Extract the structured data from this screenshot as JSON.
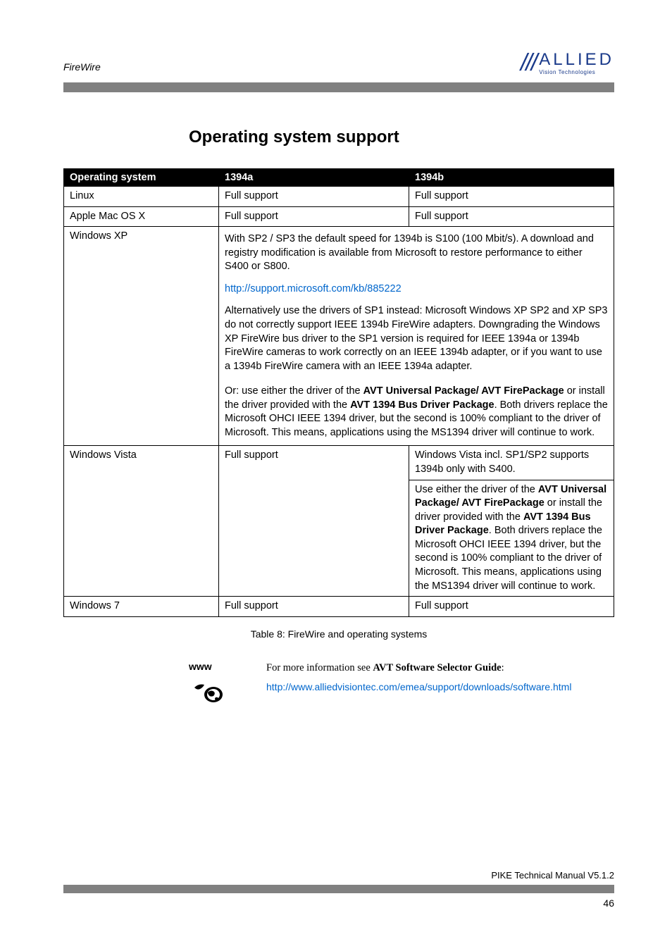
{
  "header": {
    "breadcrumb": "FireWire",
    "logo_main": "ALLIED",
    "logo_sub": "Vision Technologies"
  },
  "section_title": "Operating system support",
  "table": {
    "headers": {
      "os": "Operating system",
      "a": "1394a",
      "b": "1394b"
    },
    "linux": {
      "os": "Linux",
      "a": "Full support",
      "b": "Full support"
    },
    "mac": {
      "os": "Apple Mac OS X",
      "a": "Full support",
      "b": "Full support"
    },
    "xp": {
      "os": "Windows XP",
      "p1": "With SP2 / SP3 the default speed for 1394b is S100 (100 Mbit/s). A download and registry modification is available from Microsoft to restore performance to either S400 or S800.",
      "link": "http://support.microsoft.com/kb/885222",
      "p2": "Alternatively use the drivers of SP1 instead: Microsoft Windows XP SP2 and XP SP3 do not correctly support IEEE 1394b FireWire adapters. Downgrading the Windows XP FireWire bus driver to the SP1 version is required for IEEE 1394a or 1394b FireWire cameras to work correctly on an IEEE 1394b adapter, or if you want to use a 1394b FireWire camera with an IEEE 1394a adapter.",
      "p3_pre": "Or: use either the driver of the ",
      "p3_b1": "AVT Universal Package/ AVT FirePackage",
      "p3_mid": " or install the driver provided with the ",
      "p3_b2": "AVT 1394 Bus Driver Package",
      "p3_post": ". Both drivers replace the Microsoft OHCI IEEE 1394 driver, but the second is 100% compliant to the driver of Microsoft. This means, applications using the MS1394 driver will continue to work."
    },
    "vista": {
      "os": "Windows Vista",
      "a": "Full support",
      "b1": "Windows Vista incl. SP1/SP2 supports 1394b only with S400.",
      "b2_pre": "Use either the driver of the ",
      "b2_b1": "AVT Universal Package/ AVT FirePackage",
      "b2_mid": " or install the driver provided with the ",
      "b2_b2": "AVT 1394 Bus Driver Package",
      "b2_post": ". Both drivers replace the Microsoft OHCI IEEE 1394 driver, but the second is 100% compliant to the driver of Microsoft. This means, applications using the MS1394 driver will continue to work."
    },
    "win7": {
      "os": "Windows 7",
      "a": "Full support",
      "b": "Full support"
    }
  },
  "table_caption": "Table 8: FireWire and operating systems",
  "info": {
    "label": "www",
    "text_pre": "For more information see ",
    "text_bold": "AVT Software Selector Guide",
    "text_post": ":",
    "link": "http://www.alliedvisiontec.com/emea/support/downloads/software.html"
  },
  "footer": {
    "title": "PIKE Technical Manual V5.1.2",
    "page": "46"
  }
}
